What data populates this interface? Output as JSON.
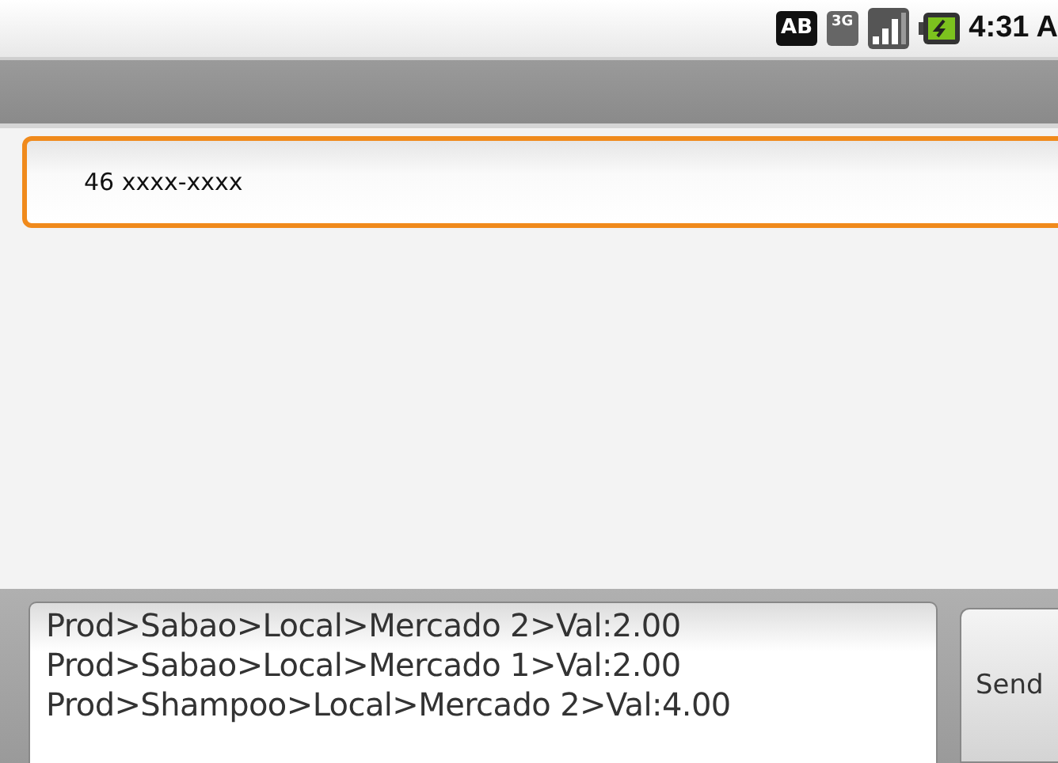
{
  "status_bar": {
    "keyboard_badge": "AB",
    "network_badge": "3G",
    "time": "4:31 A"
  },
  "recipient": {
    "value": "46 xxxx-xxxx",
    "focused": true
  },
  "message": {
    "lines": [
      "Prod>Sabao>Local>Mercado 2>Val:2.00",
      "Prod>Sabao>Local>Mercado 1>Val:2.00",
      "Prod>Shampoo>Local>Mercado 2>Val:4.00"
    ]
  },
  "send_button": {
    "label": "Send"
  }
}
